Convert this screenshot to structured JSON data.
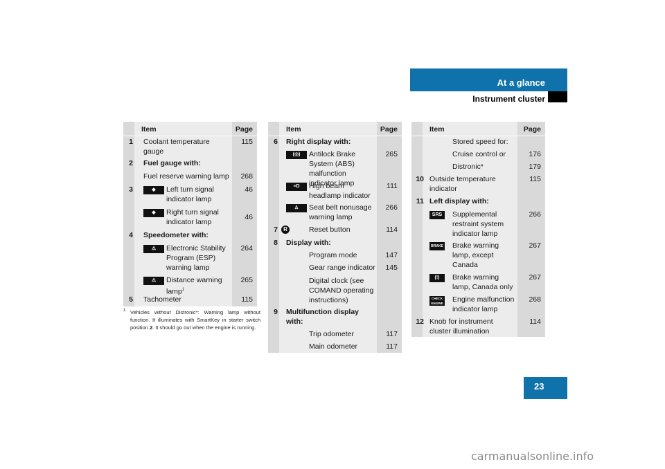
{
  "header": {
    "section": "At a glance",
    "subsection": "Instrument cluster"
  },
  "table_headers": {
    "item": "Item",
    "page": "Page"
  },
  "table1": {
    "rows": [
      {
        "num": "1",
        "text": "Coolant temperature gauge",
        "page": "115"
      },
      {
        "num": "2",
        "text": "Fuel gauge with:",
        "page": ""
      },
      {
        "num": "",
        "text": "Fuel reserve warning lamp",
        "page": "268"
      },
      {
        "num": "3",
        "icon": "left-turn-signal-icon",
        "icon_glyph": "◇",
        "text": "Left turn signal indicator lamp",
        "page": "46"
      },
      {
        "num": "",
        "icon": "right-turn-signal-icon",
        "icon_glyph": "◇",
        "text": "Right turn signal indicator lamp",
        "page": "46"
      },
      {
        "num": "4",
        "text": "Speedometer with:",
        "page": ""
      },
      {
        "num": "",
        "icon": "esp-warning-icon",
        "icon_glyph": "⚠",
        "text": "Electronic Stability Program (ESP) warning lamp",
        "page": "264"
      },
      {
        "num": "",
        "icon": "distance-warning-icon",
        "icon_glyph": "⚠",
        "text": "Distance warning lamp",
        "footnote_ref": "1",
        "page": "265"
      },
      {
        "num": "5",
        "text": "Tachometer",
        "page": "115"
      }
    ]
  },
  "footnote": {
    "marker": "1",
    "text_before": "Vehicles without Distronic*: Warning lamp without function. It illuminates with SmartKey in starter switch position ",
    "bold": "2",
    "text_after": ". It should go out when the engine is running."
  },
  "table2": {
    "rows": [
      {
        "num": "6",
        "text": "Right display with:",
        "page": ""
      },
      {
        "num": "",
        "icon": "abs-malfunction-icon",
        "icon_glyph": "(ABS)",
        "text": "Antilock Brake System (ABS) malfunction indicator lamp",
        "page": "265"
      },
      {
        "num": "",
        "icon": "high-beam-icon",
        "icon_glyph": "≡D",
        "text": "High beam headlamp indicator",
        "page": "111"
      },
      {
        "num": "",
        "icon": "seat-belt-icon",
        "icon_glyph": "♙",
        "text": "Seat belt nonusage warning lamp",
        "page": "266"
      },
      {
        "num": "7",
        "icon": "reset-button-icon",
        "icon_glyph": "R",
        "text": "Reset button",
        "page": "114"
      },
      {
        "num": "8",
        "text": "Display with:",
        "page": ""
      },
      {
        "num": "",
        "text": "Program mode",
        "page": "147"
      },
      {
        "num": "",
        "text": "Gear range indicator",
        "page": "145"
      },
      {
        "num": "",
        "text": "Digital clock (see COMAND operating instructions)",
        "page": ""
      },
      {
        "num": "9",
        "text": "Multifunction display with:",
        "page": ""
      },
      {
        "num": "",
        "text": "Trip odometer",
        "page": "117"
      },
      {
        "num": "",
        "text": "Main odometer",
        "page": "117"
      }
    ]
  },
  "table3": {
    "rows": [
      {
        "num": "",
        "text": "Stored speed for:",
        "page": ""
      },
      {
        "num": "",
        "text": "Cruise control or",
        "page": "176"
      },
      {
        "num": "",
        "text": "Distronic*",
        "page": "179"
      },
      {
        "num": "10",
        "text": "Outside temperature indicator",
        "page": "115"
      },
      {
        "num": "11",
        "text": "Left display with:",
        "page": ""
      },
      {
        "num": "",
        "icon": "srs-icon",
        "icon_glyph": "SRS",
        "text": "Supplemental restraint system indicator lamp",
        "page": "266"
      },
      {
        "num": "",
        "icon": "brake-warning-icon",
        "icon_glyph": "BRAKE",
        "text": "Brake warning lamp, except Canada",
        "page": "267"
      },
      {
        "num": "",
        "icon": "brake-warning-canada-icon",
        "icon_glyph": "(!)",
        "text": "Brake warning lamp, Canada only",
        "page": "267"
      },
      {
        "num": "",
        "icon": "check-engine-icon",
        "icon_glyph": "CHECK ENGINE",
        "text": "Engine malfunction indicator lamp",
        "page": "268"
      },
      {
        "num": "12",
        "text": "Knob for instrument cluster illumination",
        "page": "114"
      }
    ]
  },
  "page_number": "23",
  "watermark": "carmanualsonline.info"
}
